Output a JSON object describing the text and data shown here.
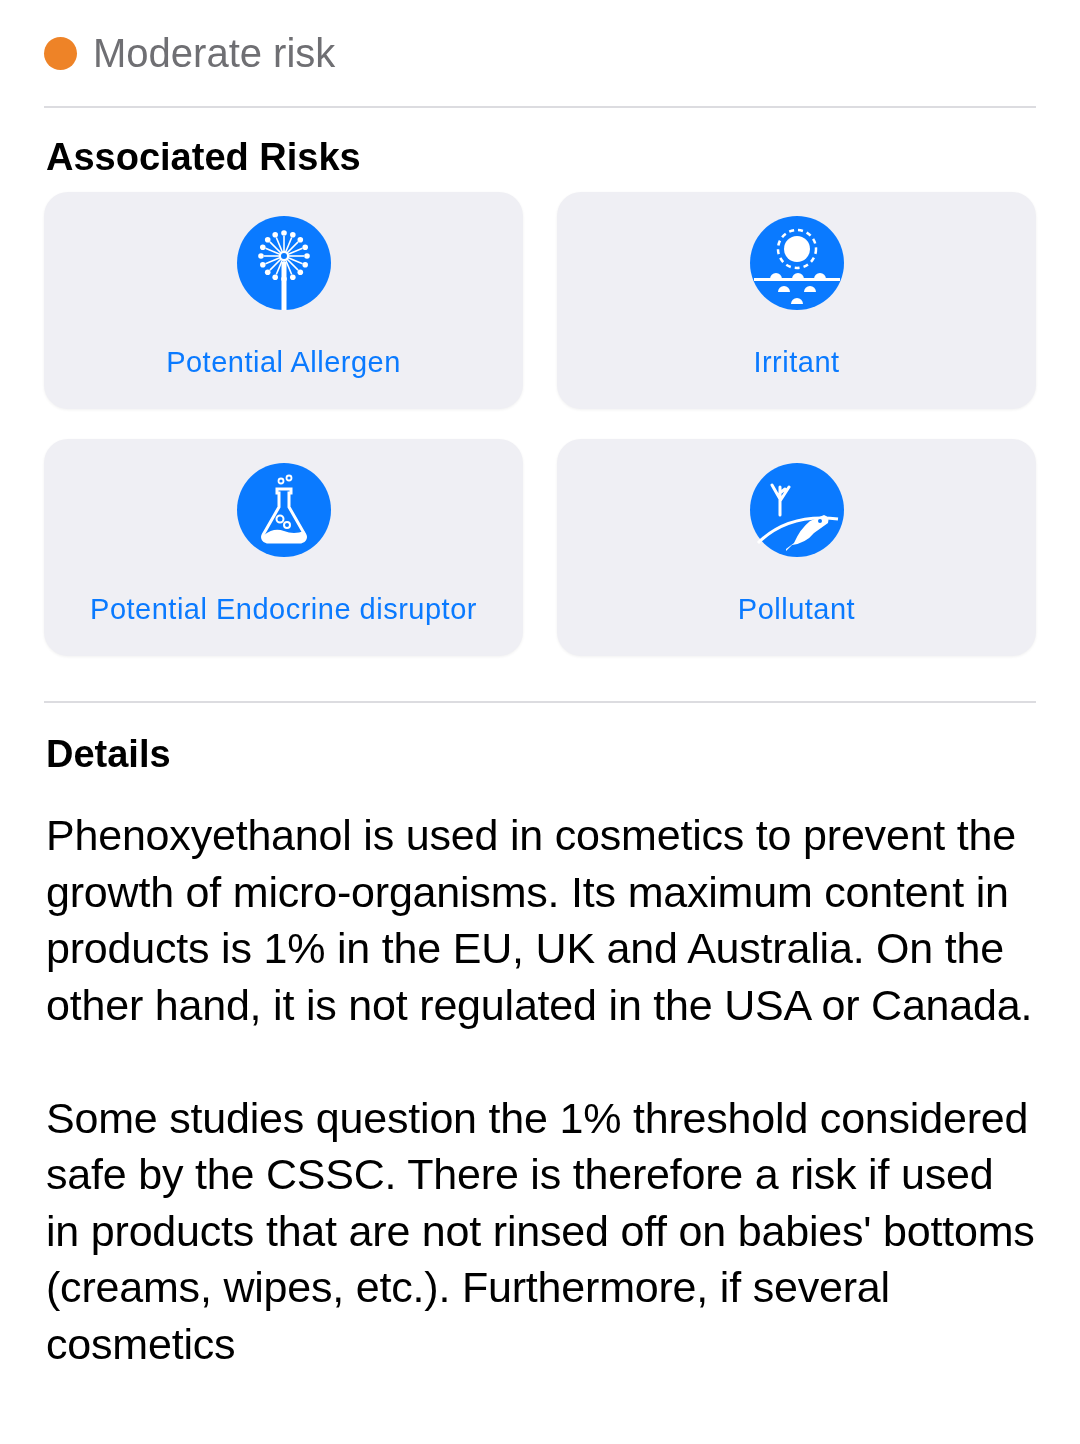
{
  "risk_level": {
    "label": "Moderate risk",
    "color": "#ee8327"
  },
  "associated_risks": {
    "title": "Associated Risks",
    "items": [
      {
        "kind": "allergen",
        "label": "Potential Allergen"
      },
      {
        "kind": "irritant",
        "label": "Irritant"
      },
      {
        "kind": "endocrine",
        "label": "Potential Endocrine disruptor"
      },
      {
        "kind": "pollutant",
        "label": "Pollutant"
      }
    ]
  },
  "details": {
    "title": "Details",
    "paragraphs": [
      "Phenoxyethanol is used in cosmetics to prevent the growth of micro-organisms. Its maximum content in products is 1% in the EU, UK and Australia. On the other hand, it is not regulated in the USA or Canada.",
      "Some studies question the 1% threshold considered safe by the CSSC. There is therefore a risk if used in products that are not rinsed off on babies' bottoms (creams, wipes, etc.). Furthermore, if several cosmetics"
    ]
  }
}
